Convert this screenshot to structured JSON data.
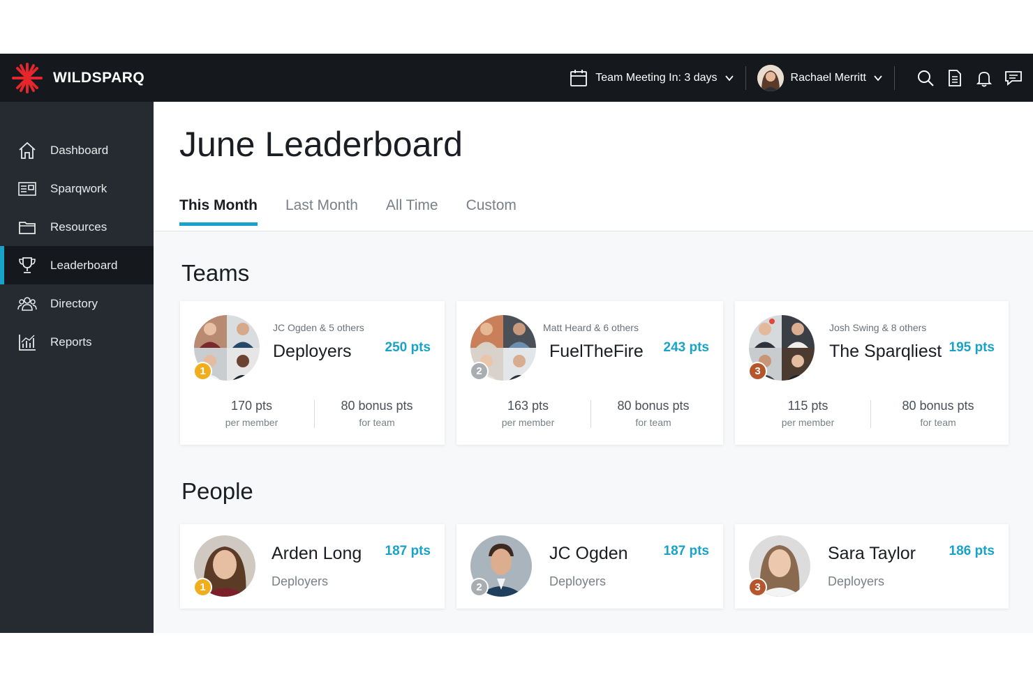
{
  "brand": {
    "name": "WILDSPARQ",
    "accent": "#19a2c9",
    "logo_color": "#e5262b"
  },
  "header": {
    "meeting_label": "Team Meeting In: 3 days",
    "user_name": "Rachael Merritt",
    "icons": [
      "calendar-icon",
      "search-icon",
      "document-icon",
      "bell-icon",
      "chat-icon"
    ]
  },
  "sidebar": {
    "items": [
      {
        "label": "Dashboard",
        "icon": "home-icon"
      },
      {
        "label": "Sparqwork",
        "icon": "sparqwork-icon"
      },
      {
        "label": "Resources",
        "icon": "folder-icon"
      },
      {
        "label": "Leaderboard",
        "icon": "trophy-icon",
        "active": true
      },
      {
        "label": "Directory",
        "icon": "people-icon"
      },
      {
        "label": "Reports",
        "icon": "chart-icon"
      }
    ]
  },
  "page": {
    "title": "June Leaderboard",
    "tabs": [
      {
        "label": "This Month",
        "active": true
      },
      {
        "label": "Last Month"
      },
      {
        "label": "All Time"
      },
      {
        "label": "Custom"
      }
    ]
  },
  "teams": {
    "title": "Teams",
    "cards": [
      {
        "rank": "1",
        "members": "JC Ogden & 5 others",
        "name": "Deployers",
        "pts": "250 pts",
        "per_member": "170 pts",
        "per_member_label": "per member",
        "bonus": "80 bonus pts",
        "bonus_label": "for team"
      },
      {
        "rank": "2",
        "members": "Matt Heard & 6 others",
        "name": "FuelTheFire",
        "pts": "243 pts",
        "per_member": "163 pts",
        "per_member_label": "per member",
        "bonus": "80 bonus pts",
        "bonus_label": "for team"
      },
      {
        "rank": "3",
        "members": "Josh Swing & 8 others",
        "name": "The Sparqliest",
        "pts": "195 pts",
        "per_member": "115 pts",
        "per_member_label": "per member",
        "bonus": "80 bonus pts",
        "bonus_label": "for team"
      }
    ]
  },
  "people": {
    "title": "People",
    "cards": [
      {
        "rank": "1",
        "name": "Arden Long",
        "team": "Deployers",
        "pts": "187 pts"
      },
      {
        "rank": "2",
        "name": "JC Ogden",
        "team": "Deployers",
        "pts": "187 pts"
      },
      {
        "rank": "3",
        "name": "Sara Taylor",
        "team": "Deployers",
        "pts": "186 pts"
      }
    ]
  }
}
